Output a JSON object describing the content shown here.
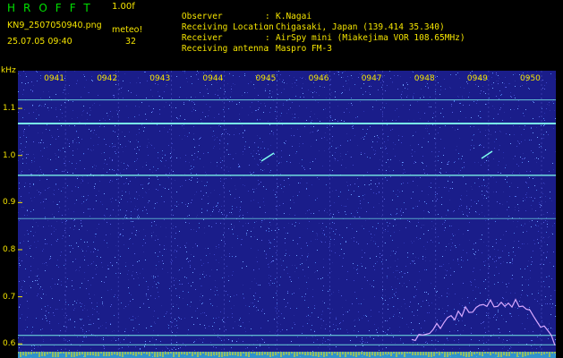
{
  "header": {
    "app_name": "HROFFT",
    "version": "1.00f",
    "filename": "KN9_2507050940.png",
    "unit": "meteo!",
    "datetime": "25.07.05 09:40",
    "count": "32",
    "info": [
      {
        "label": "Observer",
        "value": "K.Nagai"
      },
      {
        "label": "Receiving Location",
        "value": "Chigasaki, Japan (139.414 35.340)"
      },
      {
        "label": "Receiver",
        "value": "AirSpy mini (Miakejima VOR 108.65MHz)"
      },
      {
        "label": "Receiving antenna",
        "value": "Maspro FM-3"
      }
    ]
  },
  "chart_data": {
    "type": "heatmap",
    "ylabel": "kHz",
    "y_ticks": [
      "1.1",
      "1.0",
      "0.9",
      "0.8",
      "0.7",
      "0.6"
    ],
    "x_ticks": [
      "0941",
      "0942",
      "0943",
      "0944",
      "0945",
      "0946",
      "0947",
      "0948",
      "0949",
      "0950"
    ],
    "ylim": [
      0.57,
      1.18
    ],
    "xlim": [
      0,
      10
    ],
    "colors": {
      "background": "#1a1d8a",
      "text": "#f4e400",
      "signal": "#7fffee"
    }
  }
}
